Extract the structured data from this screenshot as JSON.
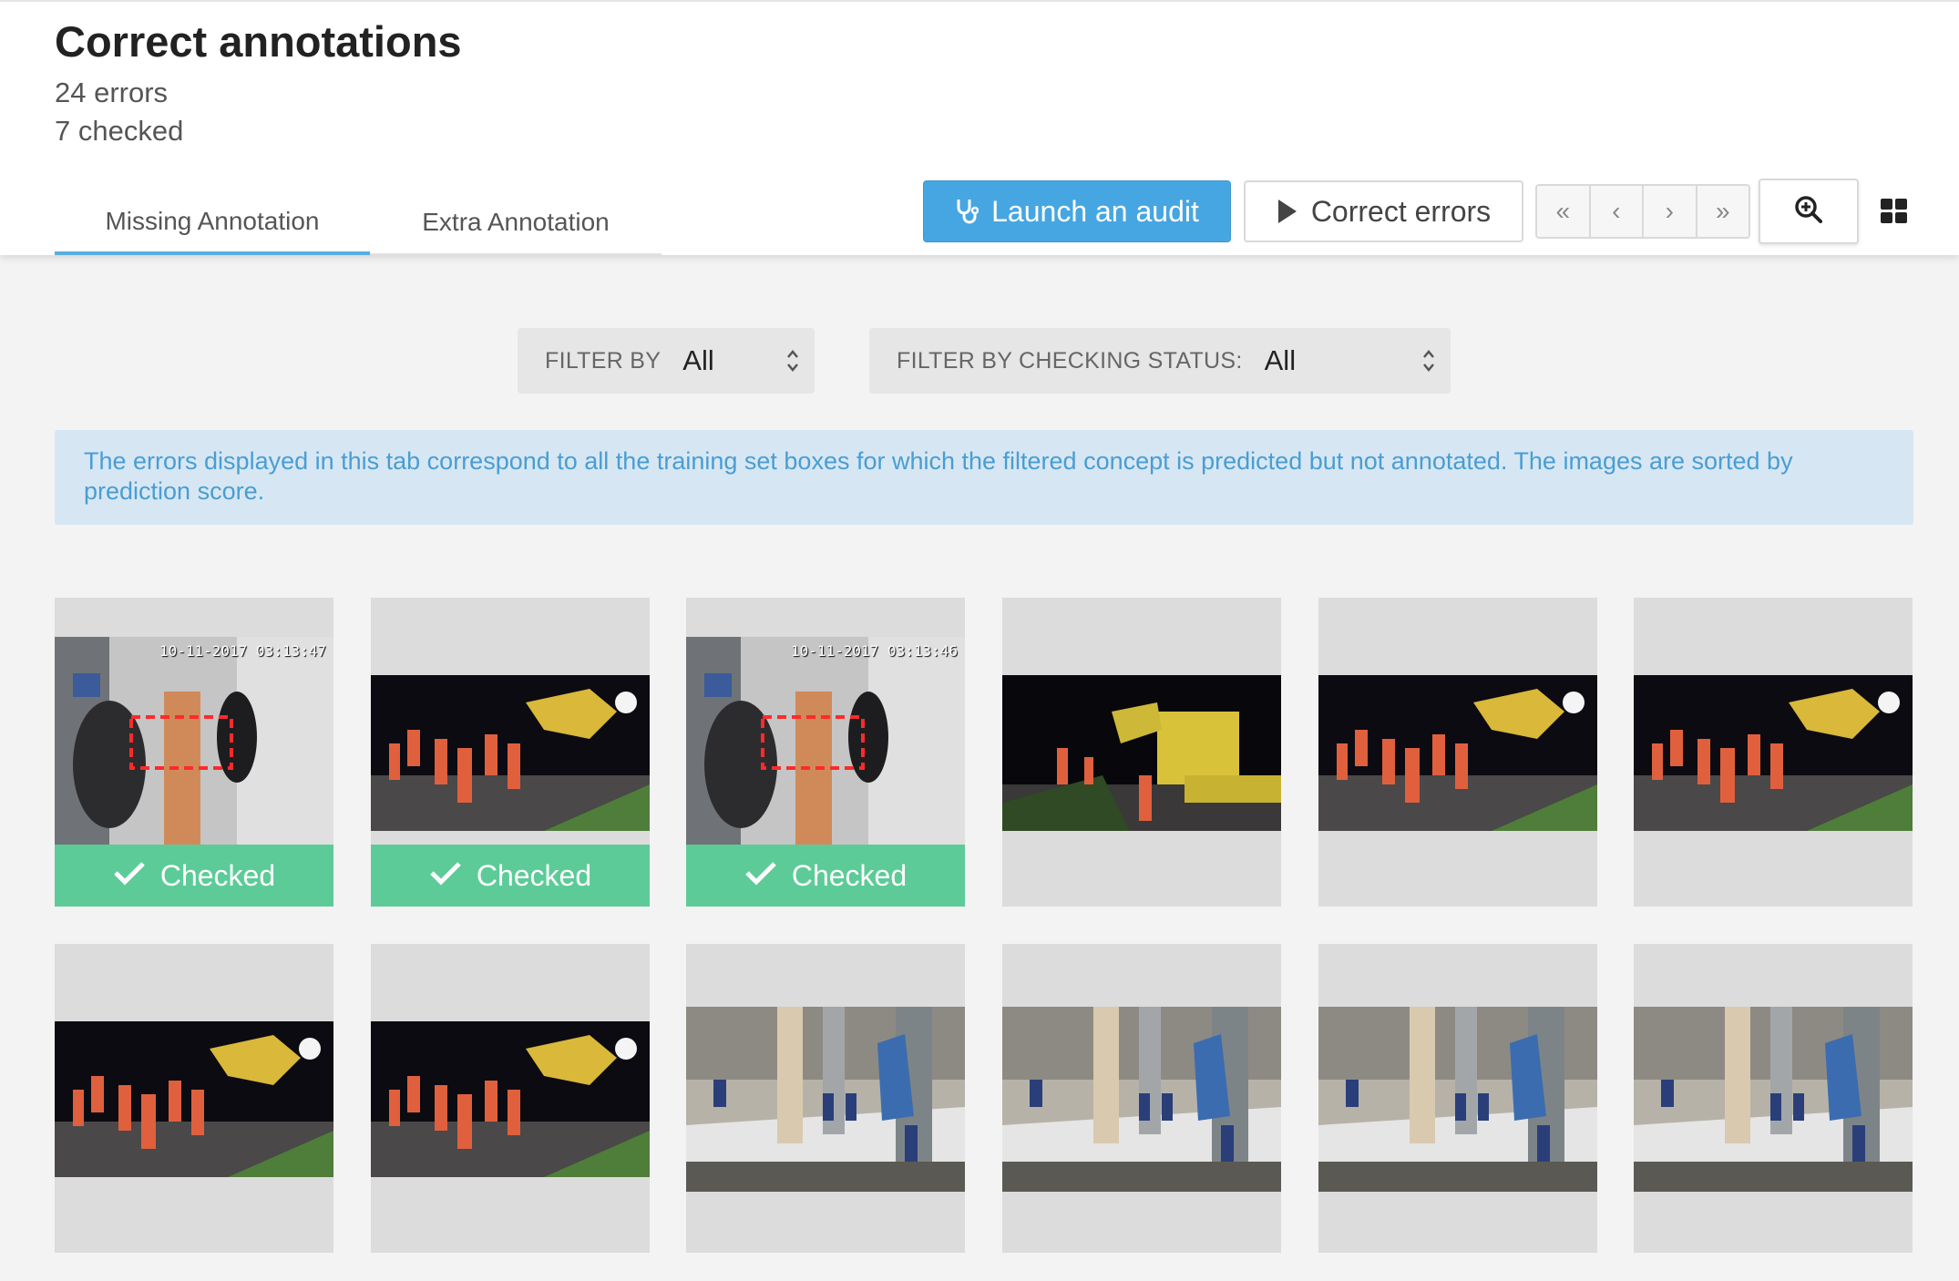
{
  "header": {
    "title": "Correct annotations",
    "errors": "24 errors",
    "checked": "7 checked"
  },
  "tabs": [
    {
      "label": "Missing Annotation",
      "active": true
    },
    {
      "label": "Extra Annotation",
      "active": false
    }
  ],
  "toolbar": {
    "launch_audit": "Launch an audit",
    "correct_errors": "Correct errors",
    "pager": [
      "«",
      "‹",
      "›",
      "»"
    ]
  },
  "filters": {
    "filter_by_label": "FILTER BY",
    "filter_by_value": "All",
    "status_label": "FILTER BY CHECKING STATUS:",
    "status_value": "All"
  },
  "info": "The errors displayed in this tab correspond to all the training set boxes for which the filtered concept is predicted but not annotated. The images are sorted by prediction score.",
  "checked_label": "Checked",
  "cards": [
    {
      "scene": "corridor",
      "checked": true,
      "stamp": "10-11-2017 03:13:47"
    },
    {
      "scene": "night",
      "checked": true
    },
    {
      "scene": "corridor",
      "checked": true,
      "stamp": "10-11-2017 03:13:46"
    },
    {
      "scene": "excavator",
      "checked": false
    },
    {
      "scene": "night",
      "checked": false
    },
    {
      "scene": "night",
      "checked": false
    },
    {
      "scene": "night",
      "checked": false
    },
    {
      "scene": "night",
      "checked": false
    },
    {
      "scene": "site",
      "checked": false
    },
    {
      "scene": "site",
      "checked": false
    },
    {
      "scene": "site",
      "checked": false
    },
    {
      "scene": "site",
      "checked": false
    }
  ],
  "colors": {
    "accent": "#46a6e2",
    "checked": "#5ccb98",
    "info_bg": "#d6e7f3"
  }
}
